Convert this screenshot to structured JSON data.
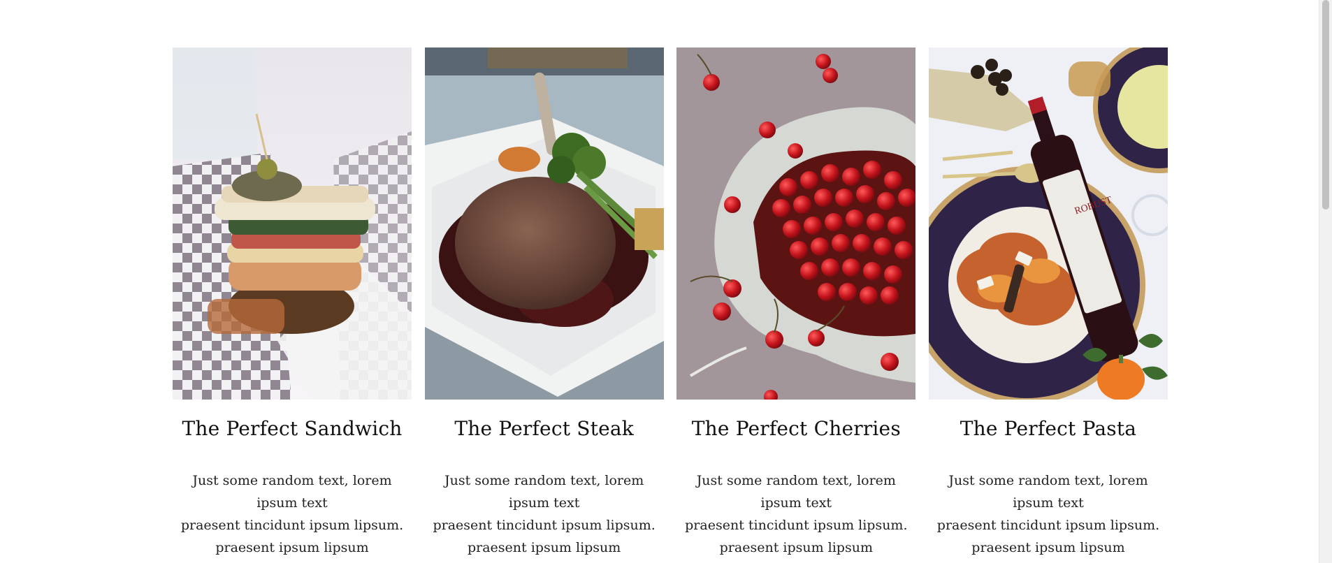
{
  "cards": [
    {
      "image": "sandwich-photo",
      "title": "The Perfect Sandwich",
      "text": {
        "line1": "Just some random text, lorem ipsum text",
        "line2": "praesent tincidunt ipsum lipsum.",
        "line3": "praesent ipsum lipsum"
      }
    },
    {
      "image": "steak-photo",
      "title": "The Perfect Steak",
      "text": {
        "line1": "Just some random text, lorem ipsum text",
        "line2": "praesent tincidunt ipsum lipsum.",
        "line3": "praesent ipsum lipsum"
      }
    },
    {
      "image": "cherries-photo",
      "title": "The Perfect Cherries",
      "text": {
        "line1": "Just some random text, lorem ipsum text",
        "line2": "praesent tincidunt ipsum lipsum.",
        "line3": "praesent ipsum lipsum"
      }
    },
    {
      "image": "pasta-photo",
      "title": "The Perfect Pasta",
      "text": {
        "line1": "Just some random text, lorem ipsum text",
        "line2": "praesent tincidunt ipsum lipsum.",
        "line3": "praesent ipsum lipsum"
      },
      "wine_label": "ROBUST"
    }
  ]
}
